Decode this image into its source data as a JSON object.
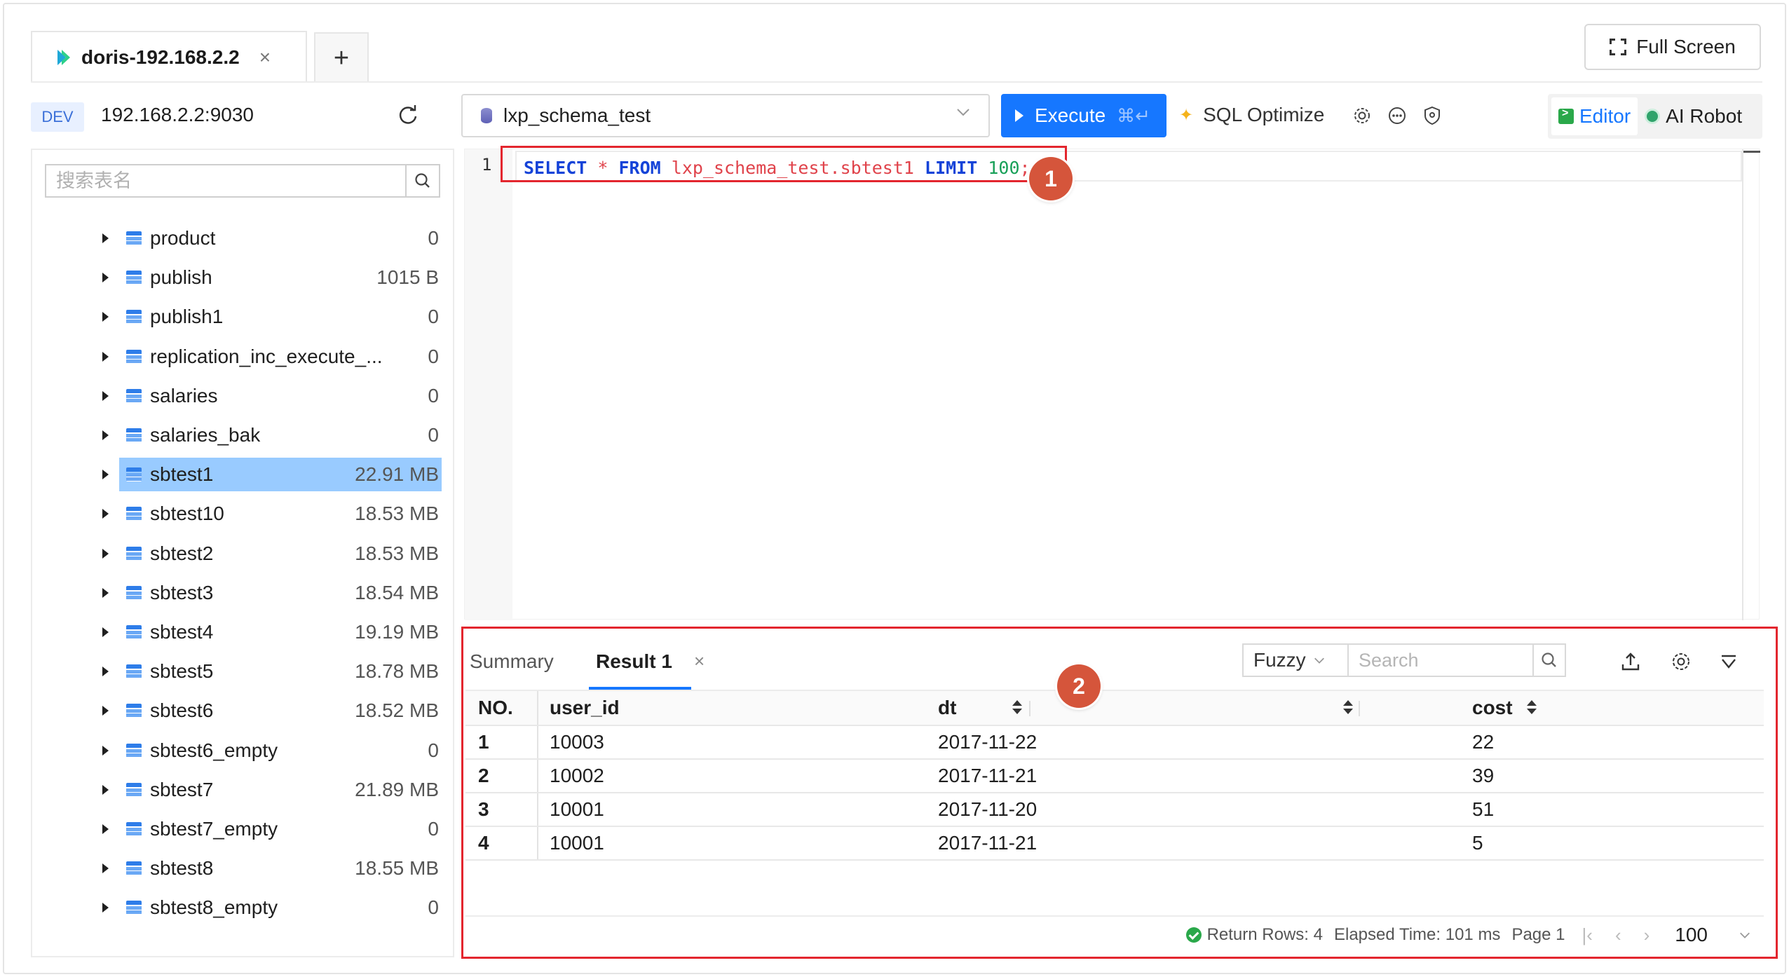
{
  "tab": {
    "name": "doris-192.168.2.2",
    "close": "×",
    "add": "+"
  },
  "fullscreen_label": "Full Screen",
  "env": {
    "badge": "DEV",
    "host": "192.168.2.2:9030"
  },
  "table_search_placeholder": "搜索表名",
  "tables": [
    {
      "name": "product",
      "size": "0"
    },
    {
      "name": "publish",
      "size": "1015 B"
    },
    {
      "name": "publish1",
      "size": "0"
    },
    {
      "name": "replication_inc_execute_...",
      "size": "0"
    },
    {
      "name": "salaries",
      "size": "0"
    },
    {
      "name": "salaries_bak",
      "size": "0"
    },
    {
      "name": "sbtest1",
      "size": "22.91 MB",
      "selected": true
    },
    {
      "name": "sbtest10",
      "size": "18.53 MB"
    },
    {
      "name": "sbtest2",
      "size": "18.53 MB"
    },
    {
      "name": "sbtest3",
      "size": "18.54 MB"
    },
    {
      "name": "sbtest4",
      "size": "19.19 MB"
    },
    {
      "name": "sbtest5",
      "size": "18.78 MB"
    },
    {
      "name": "sbtest6",
      "size": "18.52 MB"
    },
    {
      "name": "sbtest6_empty",
      "size": "0"
    },
    {
      "name": "sbtest7",
      "size": "21.89 MB"
    },
    {
      "name": "sbtest7_empty",
      "size": "0"
    },
    {
      "name": "sbtest8",
      "size": "18.55 MB"
    },
    {
      "name": "sbtest8_empty",
      "size": "0"
    }
  ],
  "toolbar": {
    "schema": "lxp_schema_test",
    "execute_label": "Execute",
    "execute_shortcut": "⌘↵",
    "sql_optimize_label": "SQL Optimize",
    "editor_label": "Editor",
    "ai_robot_label": "AI Robot"
  },
  "editor": {
    "line_number": "1",
    "tokens": {
      "select": "SELECT",
      "star": "*",
      "from": "FROM",
      "table": "lxp_schema_test.sbtest1",
      "limit": "LIMIT",
      "limit_value": "100",
      "semicolon": ";"
    }
  },
  "callouts": {
    "one": "1",
    "two": "2"
  },
  "accent_color": "#1677ff",
  "highlight_color": "#e3262e",
  "result": {
    "tabs": {
      "summary": "Summary",
      "result1": "Result 1",
      "close": "×"
    },
    "filter_mode": "Fuzzy",
    "search_placeholder": "Search",
    "columns": [
      "NO.",
      "user_id",
      "dt",
      "cost"
    ],
    "rows": [
      [
        "1",
        "10003",
        "2017-11-22",
        "22"
      ],
      [
        "2",
        "10002",
        "2017-11-21",
        "39"
      ],
      [
        "3",
        "10001",
        "2017-11-20",
        "51"
      ],
      [
        "4",
        "10001",
        "2017-11-21",
        "5"
      ]
    ],
    "footer": {
      "return_rows": "Return Rows: 4",
      "elapsed": "Elapsed Time: 101 ms",
      "page": "Page 1",
      "page_size": "100"
    }
  }
}
